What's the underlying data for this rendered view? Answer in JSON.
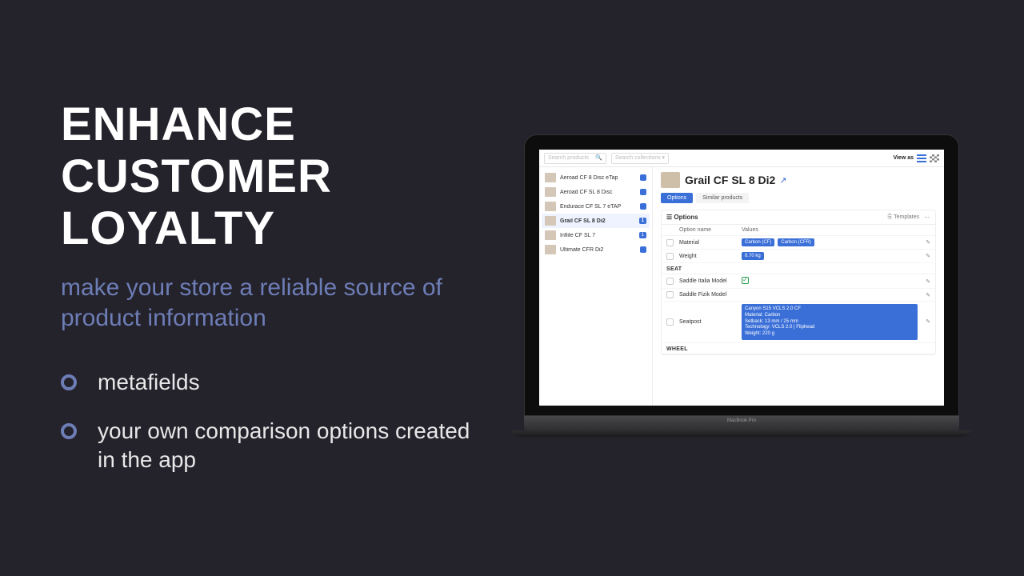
{
  "marketing": {
    "headline": "ENHANCE CUSTOMER LOYALTY",
    "subhead": "make your store a reliable source of product information",
    "bullets": [
      "metafields",
      "your own comparison options created in the app"
    ]
  },
  "app": {
    "search_products_ph": "Search products",
    "search_collections_ph": "Search collections",
    "view_as": "View as",
    "products": [
      {
        "name": "Aeroad CF 8 Disc eTap",
        "count": ""
      },
      {
        "name": "Aeroad CF SL 8 Disc",
        "count": ""
      },
      {
        "name": "Endurace CF SL 7 eTAP",
        "count": ""
      },
      {
        "name": "Grail CF SL 8 Di2",
        "count": "1",
        "selected": true
      },
      {
        "name": "Inflite CF SL 7",
        "count": "1"
      },
      {
        "name": "Ultimate CFR Di2",
        "count": ""
      }
    ],
    "title": "Grail CF SL 8 Di2",
    "tabs": {
      "options": "Options",
      "similar": "Similar products"
    },
    "panel": {
      "title": "Options",
      "templates": "Templates"
    },
    "headers": {
      "name": "Option name",
      "values": "Values"
    },
    "rows": {
      "material": {
        "name": "Material",
        "v1": "Carbon (CF)",
        "v2": "Carbon (CFR)"
      },
      "weight": {
        "name": "Weight",
        "v": "8.70 kg"
      },
      "section_seat": "SEAT",
      "saddle_italia": "Saddle Italia Model",
      "saddle_fizik": "Saddle Fizik Model",
      "seatpost": {
        "name": "Seatpost",
        "l1": "Canyon S15 VCLS 2.0 CF",
        "l2": "Material: Carbon",
        "l3": "Setback: 13 mm / 25 mm",
        "l4": "Technology: VCLS 2.0 | Fliphead",
        "l5": "Weight: 220 g"
      },
      "section_wheel": "WHEEL"
    }
  }
}
